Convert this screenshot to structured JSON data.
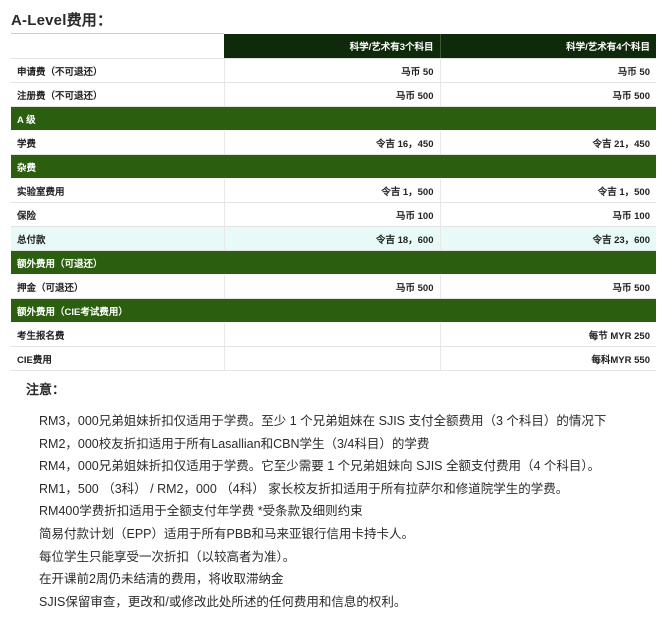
{
  "title": "A-Level费用：",
  "table": {
    "columns": [
      "",
      "科学/艺术有3个科目",
      "科学/艺术有4个科目"
    ],
    "rows": [
      {
        "type": "data",
        "cells": [
          "申请费（不可退还）",
          "马币 50",
          "马币 50"
        ]
      },
      {
        "type": "data",
        "cells": [
          "注册费（不可退还）",
          "马币 500",
          "马币 500"
        ]
      },
      {
        "type": "section",
        "cells": [
          "A 级",
          "",
          ""
        ]
      },
      {
        "type": "data",
        "cells": [
          "学费",
          "令吉 16，450",
          "令吉 21，450"
        ]
      },
      {
        "type": "section",
        "cells": [
          "杂费",
          "",
          ""
        ]
      },
      {
        "type": "data",
        "cells": [
          "实验室费用",
          "令吉 1，500",
          "令吉 1，500"
        ]
      },
      {
        "type": "data",
        "cells": [
          "保险",
          "马币 100",
          "马币 100"
        ]
      },
      {
        "type": "total",
        "cells": [
          "总付款",
          "令吉 18，600",
          "令吉 23，600"
        ]
      },
      {
        "type": "section",
        "cells": [
          "额外费用（可退还）",
          "",
          ""
        ]
      },
      {
        "type": "data",
        "cells": [
          "押金（可退还）",
          "马币 500",
          "马币 500"
        ]
      },
      {
        "type": "section",
        "cells": [
          "额外费用（CIE考试费用）",
          "",
          ""
        ]
      },
      {
        "type": "data",
        "cells": [
          "考生报名费",
          "",
          "每节 MYR 250"
        ]
      },
      {
        "type": "data",
        "cells": [
          "CIE费用",
          "",
          "每科MYR 550"
        ]
      }
    ]
  },
  "notes": {
    "title": "注意：",
    "items": [
      "RM3，000兄弟姐妹折扣仅适用于学费。至少 1 个兄弟姐妹在 SJIS 支付全额费用（3 个科目）的情况下",
      "RM2，000校友折扣适用于所有Lasallian和CBN学生（3/4科目）的学费",
      "RM4，000兄弟姐妹折扣仅适用于学费。它至少需要 1 个兄弟姐妹向 SJIS 全额支付费用（4 个科目）。",
      "RM1，500 （3科） / RM2，000 （4科） 家长校友折扣适用于所有拉萨尔和修道院学生的学费。",
      "RM400学费折扣适用于全额支付年学费 *受条款及细则约束",
      "简易付款计划（EPP）适用于所有PBB和马来亚银行信用卡持卡人。",
      "每位学生只能享受一次折扣（以较高者为准）。",
      "在开课前2周仍未结清的费用，将收取滞纳金",
      "SJIS保留审查，更改和/或修改此处所述的任何费用和信息的权利。"
    ]
  },
  "colors": {
    "header_bg": "#0f2a0a",
    "section_bg": "#2b5e0f",
    "total_bg": "#e8faf7"
  }
}
